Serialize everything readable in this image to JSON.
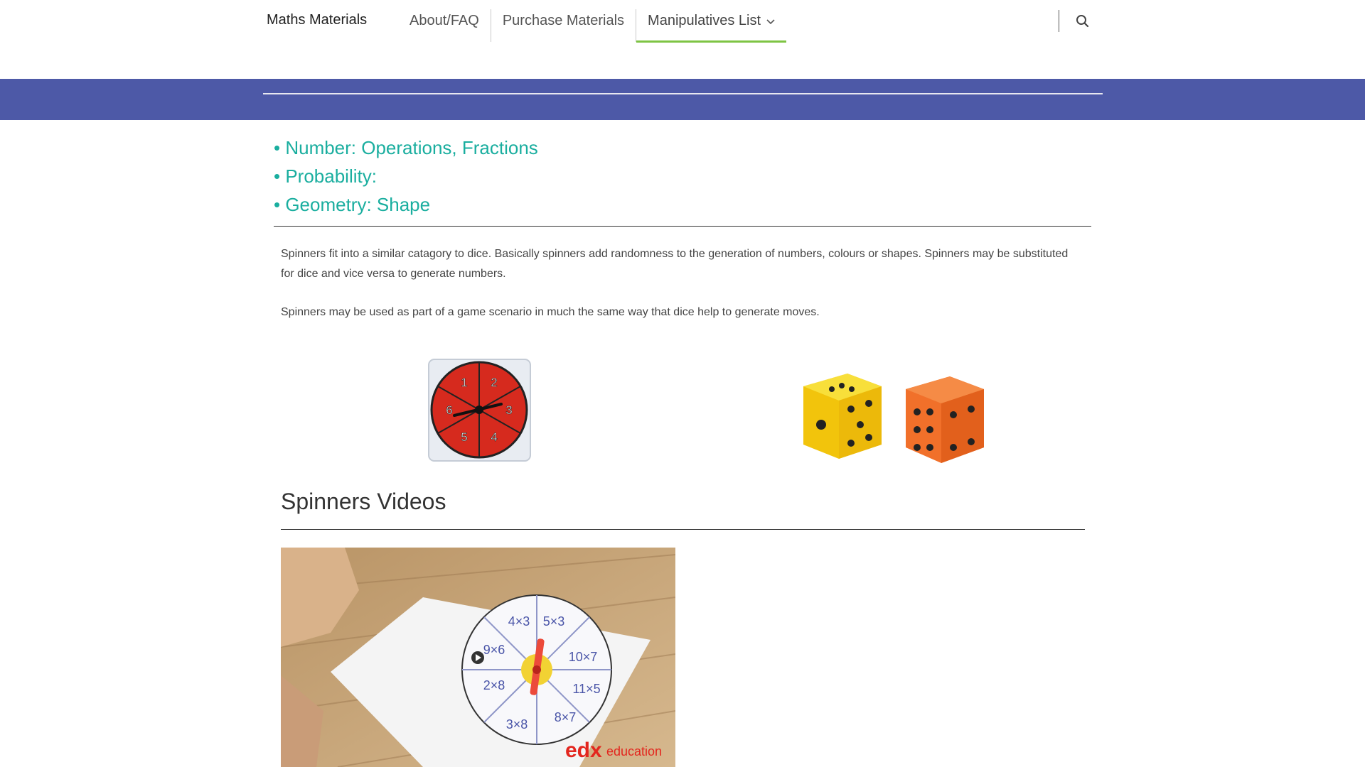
{
  "header": {
    "site_title": "Maths Materials",
    "nav": [
      {
        "label": "About/FAQ"
      },
      {
        "label": "Purchase Materials"
      },
      {
        "label": "Manipulatives List",
        "active": true,
        "has_dropdown": true
      }
    ],
    "icons": [
      "search-icon",
      "chevron-down-icon"
    ]
  },
  "colors": {
    "band": "#4d59a7",
    "topic_text": "#1aae9f",
    "active_nav_underline": "#7ec443"
  },
  "topics": [
    "• Number: Operations, Fractions",
    "• Probability:",
    "• Geometry: Shape"
  ],
  "content": {
    "p1": "Spinners fit into a similar catagory to dice. Basically spinners add randomness to the generation of numbers, colours or shapes. Spinners may be substituted for dice and vice versa to generate numbers.",
    "p2": "Spinners may be used as part of a game scenario in much the same way that dice help to generate moves."
  },
  "images": {
    "spinner": {
      "numbers": [
        "1",
        "2",
        "3",
        "4",
        "5",
        "6"
      ]
    },
    "dice": {
      "colors": [
        "#f6d316",
        "#f1702a"
      ]
    }
  },
  "videos": {
    "title": "Spinners Videos",
    "video1": {
      "brand": "edx",
      "brand_suffix": "education",
      "spinner_labels": [
        "5×3",
        "10×7",
        "11×5",
        "8×7",
        "3×8",
        "2×8",
        "9×6",
        "4×3"
      ]
    }
  }
}
